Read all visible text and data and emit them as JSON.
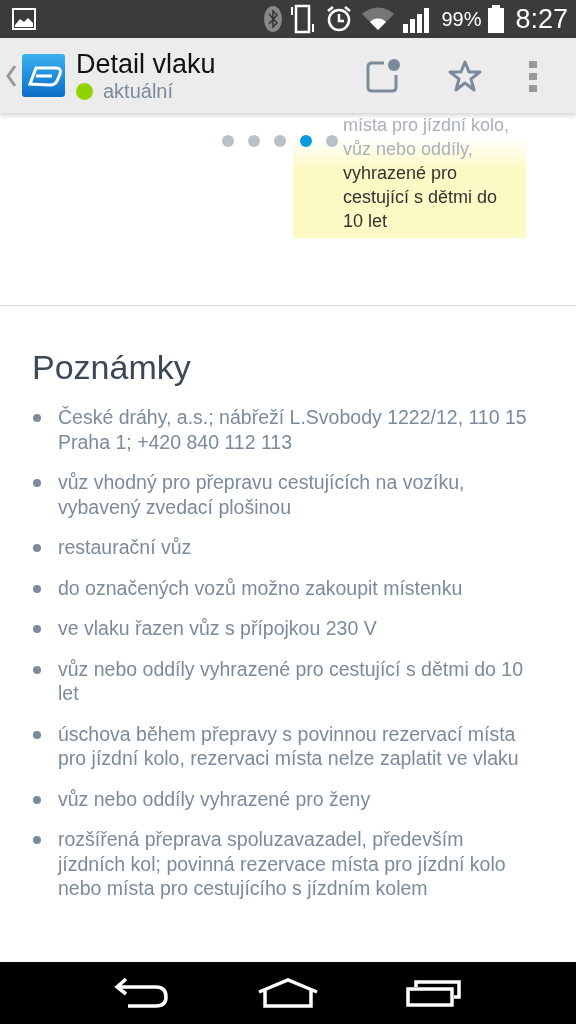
{
  "status_bar": {
    "battery": "99%",
    "time": "8:27"
  },
  "app_bar": {
    "title": "Detail vlaku",
    "status": {
      "label": "aktuální",
      "color": "#8fd400"
    }
  },
  "carousel": {
    "dots": [
      {
        "selected": false
      },
      {
        "selected": false
      },
      {
        "selected": false
      },
      {
        "selected": true
      },
      {
        "selected": false
      }
    ],
    "card_lines": [
      {
        "text": "místa pro jízdní kolo,",
        "faded": true
      },
      {
        "text": "vůz nebo oddíly,",
        "faded": true
      },
      {
        "text": "vyhrazené pro",
        "faded": false
      },
      {
        "text": "cestující s dětmi do",
        "faded": false
      },
      {
        "text": "10 let",
        "faded": false
      }
    ]
  },
  "notes": {
    "title": "Poznámky",
    "items": [
      "České dráhy, a.s.; nábřeží L.Svobody 1222/12, 110 15 Praha 1; +420 840 112 113",
      "vůz vhodný pro přepravu cestujících na vozíku, vybavený zvedací plošinou",
      "restaurační vůz",
      "do označených vozů možno zakoupit místenku",
      "ve vlaku řazen vůz s přípojkou 230 V",
      "vůz nebo oddíly vyhrazené pro cestující s dětmi do 10 let",
      "úschova během přepravy s povinnou rezervací místa pro jízdní kolo, rezervaci místa nelze zaplatit ve vlaku",
      "vůz nebo oddíly vyhrazené pro ženy",
      "rozšířená přeprava spoluzavazadel, především jízdních kol; povinná rezervace místa pro jízdní kolo nebo místa pro cestujícího s jízdním kolem"
    ]
  }
}
